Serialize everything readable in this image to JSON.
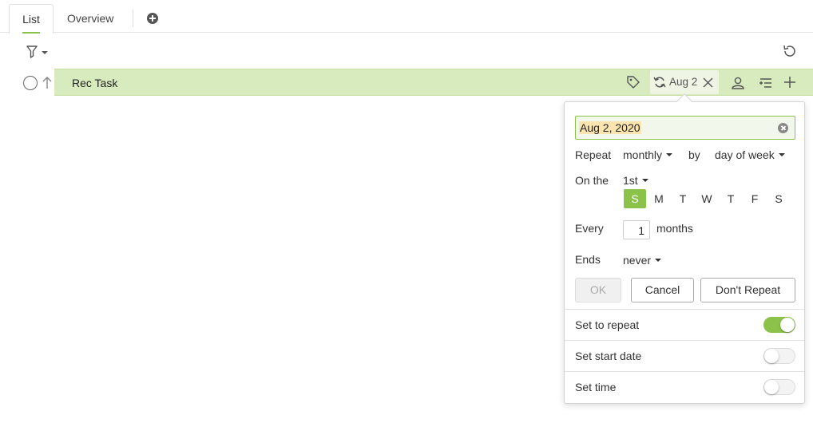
{
  "tabs": [
    {
      "label": "List",
      "active": true
    },
    {
      "label": "Overview",
      "active": false
    }
  ],
  "toolbar": {
    "filter_icon": "filter-icon",
    "reset_icon": "reset-icon"
  },
  "task": {
    "name": "Rec Task",
    "due_label": "Aug 2",
    "row_color": "#d7ebbf"
  },
  "repeat_popup": {
    "date_value": "Aug 2, 2020",
    "repeat_label": "Repeat",
    "repeat_frequency": "monthly",
    "by_label": "by",
    "by_value": "day of week",
    "on_the_label": "On the",
    "ordinal": "1st",
    "days": [
      {
        "label": "S",
        "selected": true
      },
      {
        "label": "M",
        "selected": false
      },
      {
        "label": "T",
        "selected": false
      },
      {
        "label": "W",
        "selected": false
      },
      {
        "label": "T",
        "selected": false
      },
      {
        "label": "F",
        "selected": false
      },
      {
        "label": "S",
        "selected": false
      }
    ],
    "every_label": "Every",
    "every_value": "1",
    "every_unit": "months",
    "ends_label": "Ends",
    "ends_value": "never",
    "buttons": {
      "ok": "OK",
      "cancel": "Cancel",
      "dont_repeat": "Don't Repeat"
    },
    "options": [
      {
        "label": "Set to repeat",
        "on": true
      },
      {
        "label": "Set start date",
        "on": false
      },
      {
        "label": "Set time",
        "on": false
      }
    ]
  },
  "colors": {
    "accent": "#8bc34a"
  }
}
